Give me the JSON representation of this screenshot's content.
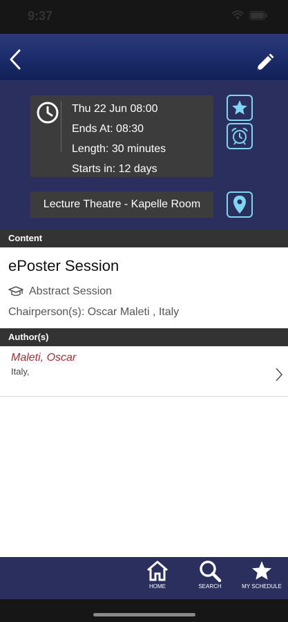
{
  "status_bar": {
    "time": "9:37"
  },
  "nav": {
    "back_icon": "chevron-left-icon",
    "edit_icon": "pencil-icon"
  },
  "session": {
    "date_line": "Thu 22  Jun  08:00",
    "ends_line": "Ends At: 08:30",
    "length_line": "Length: 30 minutes",
    "starts_in_line": "Starts in: 12 days",
    "location": "Lecture Theatre - Kapelle Room"
  },
  "content": {
    "header": "Content",
    "title": "ePoster Session",
    "type": "Abstract Session",
    "chair": "Chairperson(s): Oscar Maleti , Italy"
  },
  "authors": {
    "header": "Author(s)",
    "items": [
      {
        "name": "Maleti, Oscar",
        "country": "Italy,"
      }
    ]
  },
  "tabs": [
    {
      "label": "HOME",
      "icon": "home-icon"
    },
    {
      "label": "SEARCH",
      "icon": "search-icon"
    },
    {
      "label": "MY SCHEDULE",
      "icon": "star-icon"
    }
  ],
  "colors": {
    "nav_gradient_top": "#2e3a78",
    "panel": "#2b2f5e",
    "card": "#3c3c3c",
    "accent": "#7fd6f2",
    "author_name": "#b5292e"
  }
}
